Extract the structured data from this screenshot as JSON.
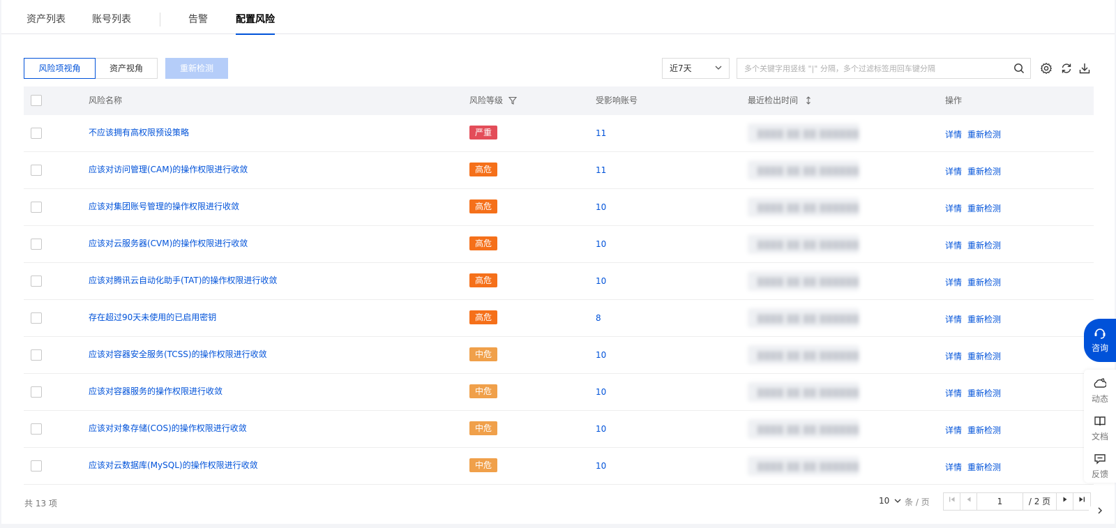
{
  "tabs": [
    {
      "label": "资产列表"
    },
    {
      "label": "账号列表"
    },
    {
      "label": "告警"
    },
    {
      "label": "配置风险"
    }
  ],
  "active_tab": "配置风险",
  "toolbar": {
    "view_risk_label": "风险项视角",
    "view_asset_label": "资产视角",
    "recheck_label": "重新检测",
    "time_range": "近7天",
    "search_placeholder": "多个关键字用竖线 \"|\" 分隔，多个过滤标签用回车键分隔"
  },
  "table": {
    "headers": {
      "name": "风险名称",
      "level": "风险等级",
      "accounts": "受影响账号",
      "time": "最近检出时间",
      "ops": "操作"
    },
    "rows": [
      {
        "name": "不应该拥有高权限预设策略",
        "level": "严重",
        "count": "11",
        "op1": "详情",
        "op2": "重新检测"
      },
      {
        "name": "应该对访问管理(CAM)的操作权限进行收敛",
        "level": "高危",
        "count": "11",
        "op1": "详情",
        "op2": "重新检测"
      },
      {
        "name": "应该对集团账号管理的操作权限进行收敛",
        "level": "高危",
        "count": "10",
        "op1": "详情",
        "op2": "重新检测"
      },
      {
        "name": "应该对云服务器(CVM)的操作权限进行收敛",
        "level": "高危",
        "count": "10",
        "op1": "详情",
        "op2": "重新检测"
      },
      {
        "name": "应该对腾讯云自动化助手(TAT)的操作权限进行收敛",
        "level": "高危",
        "count": "10",
        "op1": "详情",
        "op2": "重新检测"
      },
      {
        "name": "存在超过90天未使用的已启用密钥",
        "level": "高危",
        "count": "8",
        "op1": "详情",
        "op2": "重新检测"
      },
      {
        "name": "应该对容器安全服务(TCSS)的操作权限进行收敛",
        "level": "中危",
        "count": "10",
        "op1": "详情",
        "op2": "重新检测"
      },
      {
        "name": "应该对容器服务的操作权限进行收敛",
        "level": "中危",
        "count": "10",
        "op1": "详情",
        "op2": "重新检测"
      },
      {
        "name": "应该对对象存储(COS)的操作权限进行收敛",
        "level": "中危",
        "count": "10",
        "op1": "详情",
        "op2": "重新检测"
      },
      {
        "name": "应该对云数据库(MySQL)的操作权限进行收敛",
        "level": "中危",
        "count": "10",
        "op1": "详情",
        "op2": "重新检测"
      }
    ]
  },
  "level_colors": {
    "严重": "#e34d59",
    "高危": "#f5701a",
    "中危": "#f0a04a"
  },
  "footer": {
    "total": "共 13 项",
    "page_size": "10",
    "page_size_unit": "条 / 页",
    "current_page": "1",
    "total_pages": "/ 2 页"
  },
  "side": {
    "consult": "咨询",
    "dynamic": "动态",
    "docs": "文档",
    "feedback": "反馈"
  },
  "icons": [
    "search-icon",
    "filter-icon",
    "sort-icon",
    "settings-icon",
    "refresh-icon",
    "download-icon",
    "consult-icon",
    "dynamic-icon",
    "docs-icon",
    "feedback-icon",
    "collapse-icon"
  ]
}
